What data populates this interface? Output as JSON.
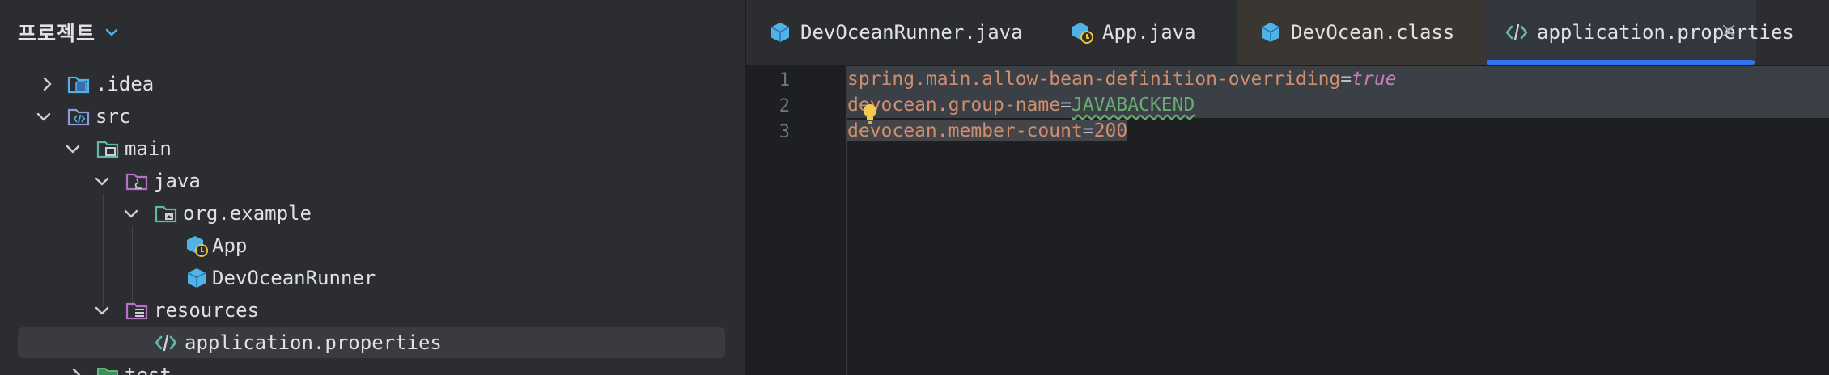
{
  "project_panel": {
    "title": "프로젝트",
    "tree": [
      {
        "label": ".idea",
        "expanded": false,
        "icon": "idea-folder-icon"
      },
      {
        "label": "src",
        "expanded": true,
        "icon": "source-folder-icon"
      },
      {
        "label": "main",
        "expanded": true,
        "icon": "module-folder-icon"
      },
      {
        "label": "java",
        "expanded": true,
        "icon": "java-source-folder-icon"
      },
      {
        "label": "org.example",
        "expanded": true,
        "icon": "package-icon"
      },
      {
        "label": "App",
        "icon": "java-class-runnable-icon"
      },
      {
        "label": "DevOceanRunner",
        "icon": "java-class-icon"
      },
      {
        "label": "resources",
        "expanded": true,
        "icon": "resources-folder-icon"
      },
      {
        "label": "application.properties",
        "icon": "properties-file-icon",
        "selected": true
      },
      {
        "label": "test",
        "expanded": false,
        "icon": "test-folder-icon"
      }
    ]
  },
  "tabs": [
    {
      "label": "DevOceanRunner.java",
      "icon": "java-class-icon"
    },
    {
      "label": "App.java",
      "icon": "java-class-runnable-icon"
    },
    {
      "label": "DevOcean.class",
      "icon": "java-class-icon"
    },
    {
      "label": "application.properties",
      "icon": "properties-file-icon",
      "active": true
    }
  ],
  "editor": {
    "line_numbers": [
      "1",
      "2",
      "3"
    ],
    "lines": [
      {
        "key": "spring.main.allow-bean-definition-overriding",
        "sep": "=",
        "value": "true"
      },
      {
        "key": "devocean.group-name",
        "sep": "=",
        "value": "JAVABACKEND"
      },
      {
        "key": "devocean.member-count",
        "sep": "=",
        "value": "200"
      }
    ]
  },
  "colors": {
    "background": "#2b2d30",
    "editor_background": "#1e1f22",
    "accent": "#3574f0",
    "property_key": "#cf8e6d",
    "keyword": "#c77dbb",
    "string_value": "#6aab73"
  }
}
